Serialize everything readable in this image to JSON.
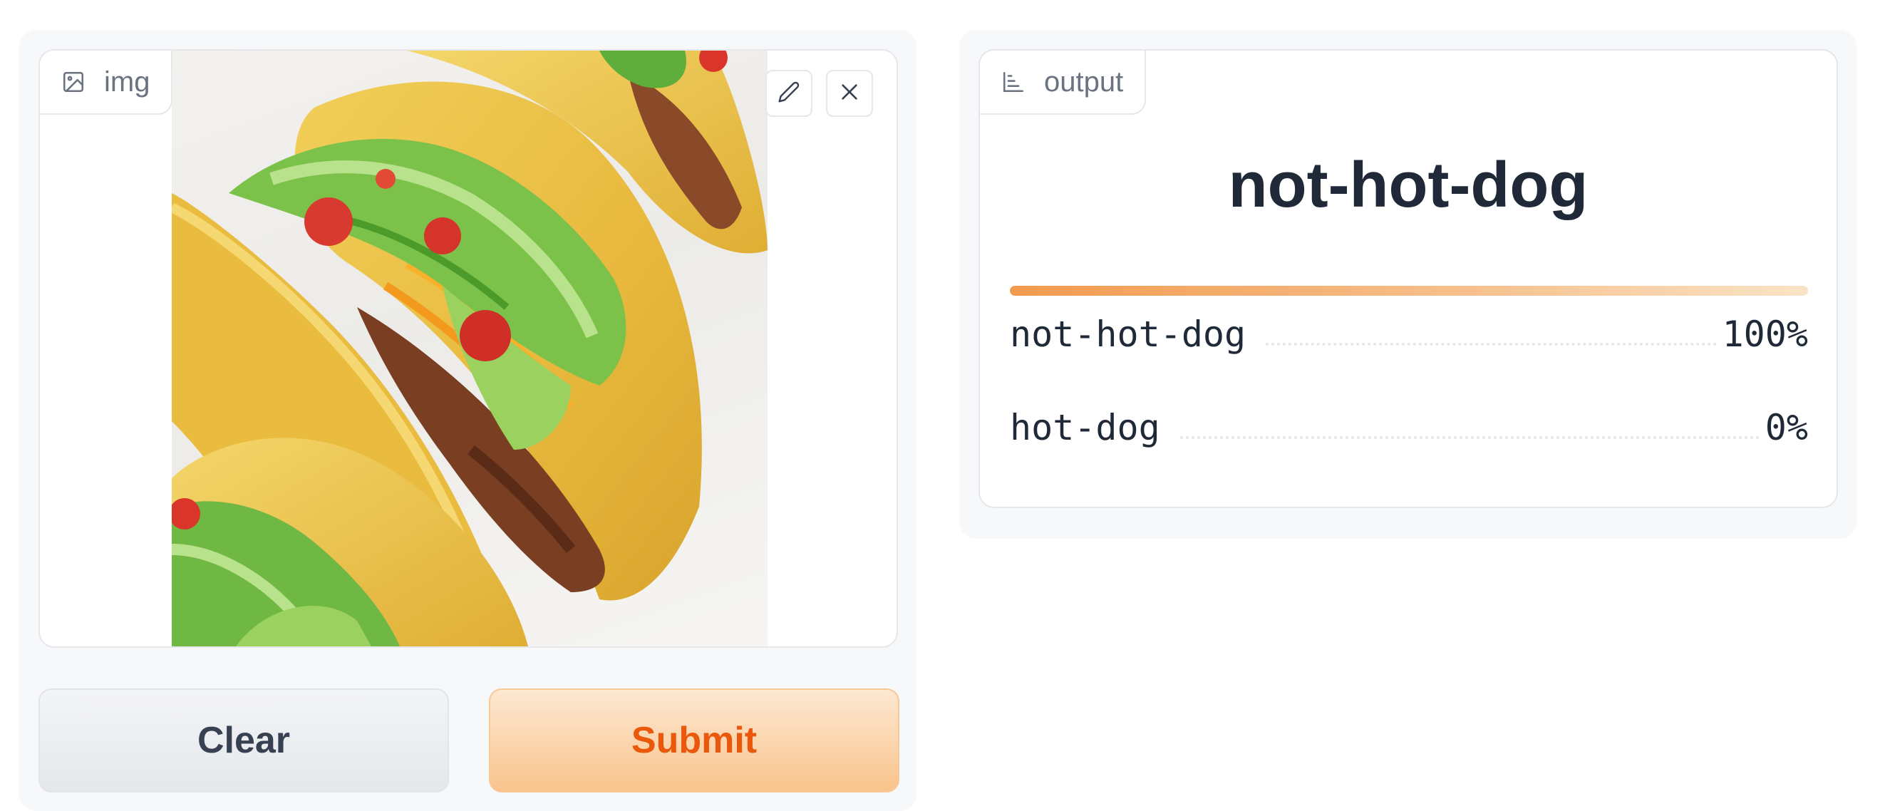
{
  "input": {
    "label": "img",
    "image_alt": "tacos",
    "icons": {
      "tab": "image-icon",
      "edit": "pencil-icon",
      "close": "close-icon"
    }
  },
  "buttons": {
    "clear": "Clear",
    "submit": "Submit"
  },
  "output": {
    "label": "output",
    "tab_icon": "bar-chart-icon",
    "predicted": "not-hot-dog",
    "top_confidence": 1.0,
    "confidences": [
      {
        "label": "not-hot-dog",
        "value": "100%"
      },
      {
        "label": "hot-dog",
        "value": "0%"
      }
    ]
  },
  "colors": {
    "accent": "#f29a4e",
    "submit_text": "#ea580c",
    "panel_bg": "#f7f8fa",
    "border": "#e5e7eb"
  }
}
